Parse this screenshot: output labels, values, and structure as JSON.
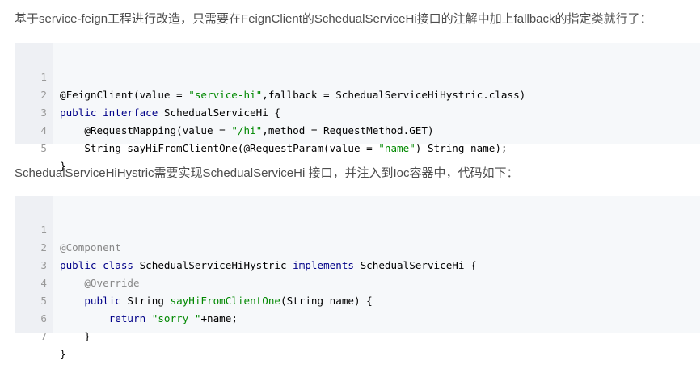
{
  "intro_paragraph": "基于service-feign工程进行改造，只需要在FeignClient的SchedualServiceHi接口的注解中加上fallback的指定类就行了：",
  "second_paragraph": "SchedualServiceHiHystric需要实现SchedualServiceHi 接口，并注入到Ioc容器中，代码如下：",
  "code_block_1": {
    "line_numbers": [
      "1",
      "2",
      "3",
      "4",
      "5"
    ],
    "l1": {
      "a": "@FeignClient(value = ",
      "b": "\"service-hi\"",
      "c": ",fallback = SchedualServiceHiHystric.class)"
    },
    "l2": {
      "kw1": "public",
      "kw2": "interface",
      "c": " SchedualServiceHi {"
    },
    "l3": {
      "a": "    @RequestMapping(value = ",
      "b": "\"/hi\"",
      "c": ",method = RequestMethod.GET)"
    },
    "l4": {
      "a": "    String sayHiFromClientOne(@RequestParam(value = ",
      "b": "\"name\"",
      "c": ") String name);"
    },
    "l5": {
      "a": "}"
    }
  },
  "code_block_2": {
    "line_numbers": [
      "1",
      "2",
      "3",
      "4",
      "5",
      "6",
      "7"
    ],
    "l1": {
      "ann": "@Component"
    },
    "l2": {
      "kw1": "public",
      "kw2": "class",
      "a": " SchedualServiceHiHystric ",
      "kw3": "implements",
      "b": " SchedualServiceHi {"
    },
    "l3": {
      "pad": "    ",
      "ann": "@Override"
    },
    "l4": {
      "pad": "    ",
      "kw": "public",
      "a": " String ",
      "fn": "sayHiFromClientOne",
      "b": "(String name) {"
    },
    "l5": {
      "pad": "        ",
      "kw": "return",
      "a": " ",
      "str": "\"sorry \"",
      "b": "+name;"
    },
    "l6": {
      "a": "    }"
    },
    "l7": {
      "a": "}"
    }
  }
}
